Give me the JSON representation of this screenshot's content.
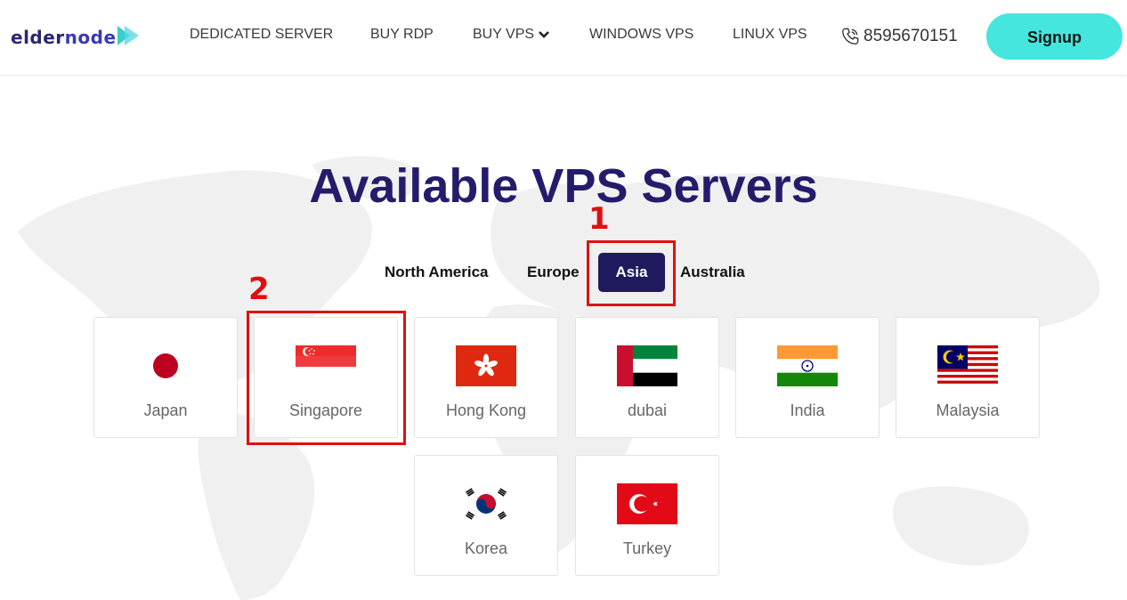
{
  "header": {
    "logo_text_dark": "elder",
    "logo_text_light": "node",
    "nav": [
      {
        "label": "DEDICATED SERVER"
      },
      {
        "label": "BUY RDP"
      },
      {
        "label": "BUY VPS"
      },
      {
        "label": "WINDOWS VPS"
      },
      {
        "label": "LINUX VPS"
      }
    ],
    "phone": "8595670151",
    "signup_label": "Signup"
  },
  "main": {
    "title": "Available VPS Servers",
    "tabs": [
      {
        "label": "North America",
        "active": false
      },
      {
        "label": "Europe",
        "active": false
      },
      {
        "label": "Asia",
        "active": true
      },
      {
        "label": "Australia",
        "active": false
      }
    ],
    "locations": [
      {
        "name": "Japan"
      },
      {
        "name": "Singapore"
      },
      {
        "name": "Hong Kong"
      },
      {
        "name": "dubai"
      },
      {
        "name": "India"
      },
      {
        "name": "Malaysia"
      },
      {
        "name": "Korea"
      },
      {
        "name": "Turkey"
      }
    ]
  },
  "annotations": {
    "marker_1": "1",
    "marker_2": "2",
    "highlight_color": "#e01010"
  },
  "colors": {
    "accent": "#44e6de",
    "title": "#241c6b",
    "active_tab": "#1f1a5e"
  }
}
